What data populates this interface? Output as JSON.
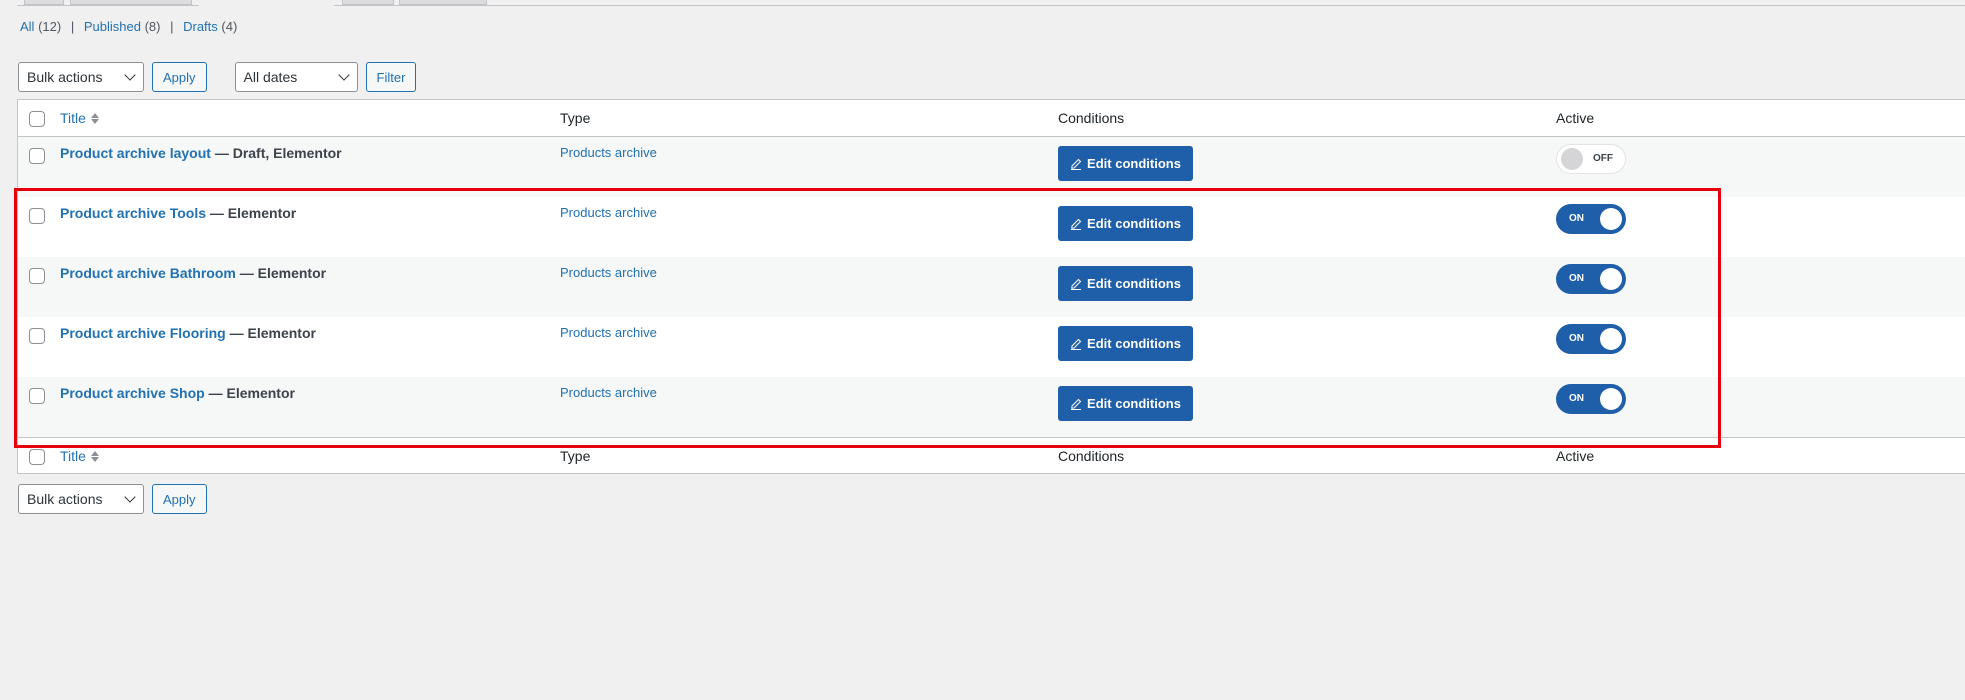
{
  "filters": [
    {
      "label": "All",
      "count": "(12)"
    },
    {
      "label": "Published",
      "count": "(8)"
    },
    {
      "label": "Drafts",
      "count": "(4)"
    }
  ],
  "separator": "|",
  "top_nav": {
    "bulk_actions": "Bulk actions",
    "apply": "Apply",
    "dates": "All dates",
    "filter": "Filter"
  },
  "bottom_nav": {
    "bulk_actions": "Bulk actions",
    "apply": "Apply"
  },
  "columns": {
    "title": "Title",
    "type": "Type",
    "conditions": "Conditions",
    "active": "Active"
  },
  "rows": [
    {
      "title": "Product archive layout",
      "suffix": " — Draft, Elementor",
      "type": "Products archive",
      "button": "Edit conditions",
      "active": false,
      "toggle_label": "OFF"
    },
    {
      "title": "Product archive Tools",
      "suffix": " — Elementor",
      "type": "Products archive",
      "button": "Edit conditions",
      "active": true,
      "toggle_label": "ON"
    },
    {
      "title": "Product archive Bathroom",
      "suffix": " — Elementor",
      "type": "Products archive",
      "button": "Edit conditions",
      "active": true,
      "toggle_label": "ON"
    },
    {
      "title": "Product archive Flooring",
      "suffix": " — Elementor",
      "type": "Products archive",
      "button": "Edit conditions",
      "active": true,
      "toggle_label": "ON"
    },
    {
      "title": "Product archive Shop",
      "suffix": " — Elementor",
      "type": "Products archive",
      "button": "Edit conditions",
      "active": true,
      "toggle_label": "ON"
    }
  ],
  "colors": {
    "accent": "#2271b1",
    "button": "#1f5ea8",
    "highlight": "#e5000c"
  }
}
